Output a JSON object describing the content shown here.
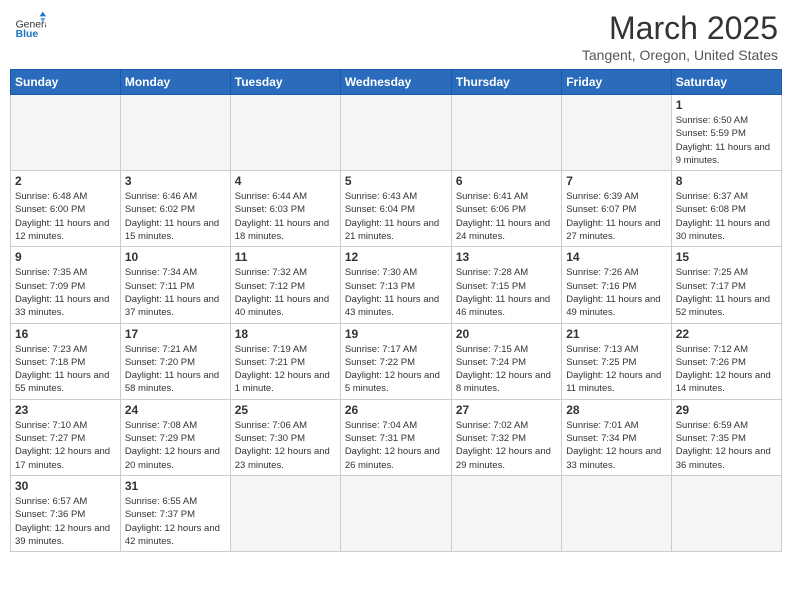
{
  "logo": {
    "text_general": "General",
    "text_blue": "Blue"
  },
  "header": {
    "title": "March 2025",
    "location": "Tangent, Oregon, United States"
  },
  "weekdays": [
    "Sunday",
    "Monday",
    "Tuesday",
    "Wednesday",
    "Thursday",
    "Friday",
    "Saturday"
  ],
  "weeks": [
    [
      {
        "day": "",
        "info": ""
      },
      {
        "day": "",
        "info": ""
      },
      {
        "day": "",
        "info": ""
      },
      {
        "day": "",
        "info": ""
      },
      {
        "day": "",
        "info": ""
      },
      {
        "day": "",
        "info": ""
      },
      {
        "day": "1",
        "info": "Sunrise: 6:50 AM\nSunset: 5:59 PM\nDaylight: 11 hours and 9 minutes."
      }
    ],
    [
      {
        "day": "2",
        "info": "Sunrise: 6:48 AM\nSunset: 6:00 PM\nDaylight: 11 hours and 12 minutes."
      },
      {
        "day": "3",
        "info": "Sunrise: 6:46 AM\nSunset: 6:02 PM\nDaylight: 11 hours and 15 minutes."
      },
      {
        "day": "4",
        "info": "Sunrise: 6:44 AM\nSunset: 6:03 PM\nDaylight: 11 hours and 18 minutes."
      },
      {
        "day": "5",
        "info": "Sunrise: 6:43 AM\nSunset: 6:04 PM\nDaylight: 11 hours and 21 minutes."
      },
      {
        "day": "6",
        "info": "Sunrise: 6:41 AM\nSunset: 6:06 PM\nDaylight: 11 hours and 24 minutes."
      },
      {
        "day": "7",
        "info": "Sunrise: 6:39 AM\nSunset: 6:07 PM\nDaylight: 11 hours and 27 minutes."
      },
      {
        "day": "8",
        "info": "Sunrise: 6:37 AM\nSunset: 6:08 PM\nDaylight: 11 hours and 30 minutes."
      }
    ],
    [
      {
        "day": "9",
        "info": "Sunrise: 7:35 AM\nSunset: 7:09 PM\nDaylight: 11 hours and 33 minutes."
      },
      {
        "day": "10",
        "info": "Sunrise: 7:34 AM\nSunset: 7:11 PM\nDaylight: 11 hours and 37 minutes."
      },
      {
        "day": "11",
        "info": "Sunrise: 7:32 AM\nSunset: 7:12 PM\nDaylight: 11 hours and 40 minutes."
      },
      {
        "day": "12",
        "info": "Sunrise: 7:30 AM\nSunset: 7:13 PM\nDaylight: 11 hours and 43 minutes."
      },
      {
        "day": "13",
        "info": "Sunrise: 7:28 AM\nSunset: 7:15 PM\nDaylight: 11 hours and 46 minutes."
      },
      {
        "day": "14",
        "info": "Sunrise: 7:26 AM\nSunset: 7:16 PM\nDaylight: 11 hours and 49 minutes."
      },
      {
        "day": "15",
        "info": "Sunrise: 7:25 AM\nSunset: 7:17 PM\nDaylight: 11 hours and 52 minutes."
      }
    ],
    [
      {
        "day": "16",
        "info": "Sunrise: 7:23 AM\nSunset: 7:18 PM\nDaylight: 11 hours and 55 minutes."
      },
      {
        "day": "17",
        "info": "Sunrise: 7:21 AM\nSunset: 7:20 PM\nDaylight: 11 hours and 58 minutes."
      },
      {
        "day": "18",
        "info": "Sunrise: 7:19 AM\nSunset: 7:21 PM\nDaylight: 12 hours and 1 minute."
      },
      {
        "day": "19",
        "info": "Sunrise: 7:17 AM\nSunset: 7:22 PM\nDaylight: 12 hours and 5 minutes."
      },
      {
        "day": "20",
        "info": "Sunrise: 7:15 AM\nSunset: 7:24 PM\nDaylight: 12 hours and 8 minutes."
      },
      {
        "day": "21",
        "info": "Sunrise: 7:13 AM\nSunset: 7:25 PM\nDaylight: 12 hours and 11 minutes."
      },
      {
        "day": "22",
        "info": "Sunrise: 7:12 AM\nSunset: 7:26 PM\nDaylight: 12 hours and 14 minutes."
      }
    ],
    [
      {
        "day": "23",
        "info": "Sunrise: 7:10 AM\nSunset: 7:27 PM\nDaylight: 12 hours and 17 minutes."
      },
      {
        "day": "24",
        "info": "Sunrise: 7:08 AM\nSunset: 7:29 PM\nDaylight: 12 hours and 20 minutes."
      },
      {
        "day": "25",
        "info": "Sunrise: 7:06 AM\nSunset: 7:30 PM\nDaylight: 12 hours and 23 minutes."
      },
      {
        "day": "26",
        "info": "Sunrise: 7:04 AM\nSunset: 7:31 PM\nDaylight: 12 hours and 26 minutes."
      },
      {
        "day": "27",
        "info": "Sunrise: 7:02 AM\nSunset: 7:32 PM\nDaylight: 12 hours and 29 minutes."
      },
      {
        "day": "28",
        "info": "Sunrise: 7:01 AM\nSunset: 7:34 PM\nDaylight: 12 hours and 33 minutes."
      },
      {
        "day": "29",
        "info": "Sunrise: 6:59 AM\nSunset: 7:35 PM\nDaylight: 12 hours and 36 minutes."
      }
    ],
    [
      {
        "day": "30",
        "info": "Sunrise: 6:57 AM\nSunset: 7:36 PM\nDaylight: 12 hours and 39 minutes."
      },
      {
        "day": "31",
        "info": "Sunrise: 6:55 AM\nSunset: 7:37 PM\nDaylight: 12 hours and 42 minutes."
      },
      {
        "day": "",
        "info": ""
      },
      {
        "day": "",
        "info": ""
      },
      {
        "day": "",
        "info": ""
      },
      {
        "day": "",
        "info": ""
      },
      {
        "day": "",
        "info": ""
      }
    ]
  ]
}
